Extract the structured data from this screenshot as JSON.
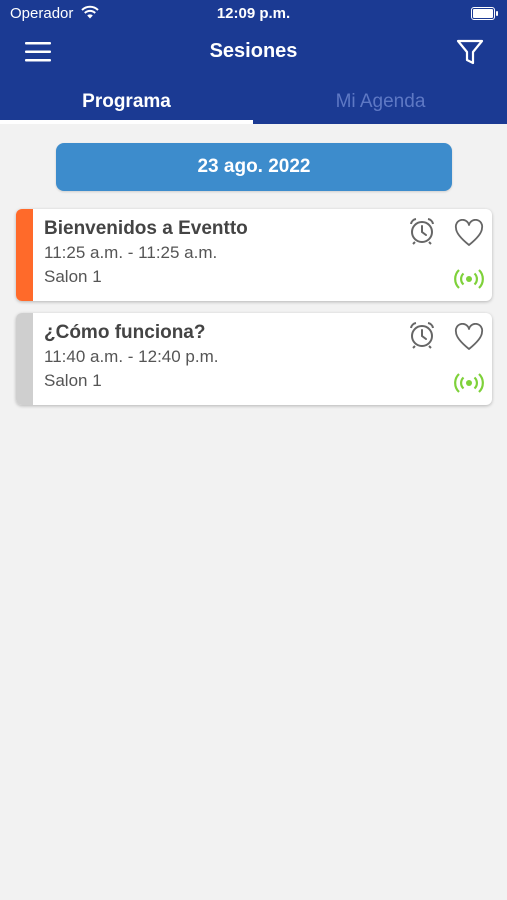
{
  "status_bar": {
    "carrier": "Operador",
    "time": "12:09 p.m."
  },
  "header": {
    "title": "Sesiones"
  },
  "tabs": [
    {
      "label": "Programa",
      "active": true
    },
    {
      "label": "Mi Agenda",
      "active": false
    }
  ],
  "date_filter": "23 ago. 2022",
  "colors": {
    "header": "#1b3a93",
    "date_pill": "#3d8ccc",
    "live": "#7ed13a",
    "bar_active": "#ff6a2a",
    "bar_inactive": "#cfcfcf"
  },
  "sessions": [
    {
      "title": "Bienvenidos a Eventto",
      "time": "11:25 a.m. - 11:25 a.m.",
      "room": "Salon 1",
      "bar_color": "#ff6a2a",
      "icons": [
        "alarm-icon",
        "heart-icon",
        "live-broadcast-icon"
      ]
    },
    {
      "title": "¿Cómo funciona?",
      "time": "11:40 a.m. - 12:40 p.m.",
      "room": "Salon 1",
      "bar_color": "#cfcfcf",
      "icons": [
        "alarm-icon",
        "heart-icon",
        "live-broadcast-icon"
      ]
    }
  ]
}
